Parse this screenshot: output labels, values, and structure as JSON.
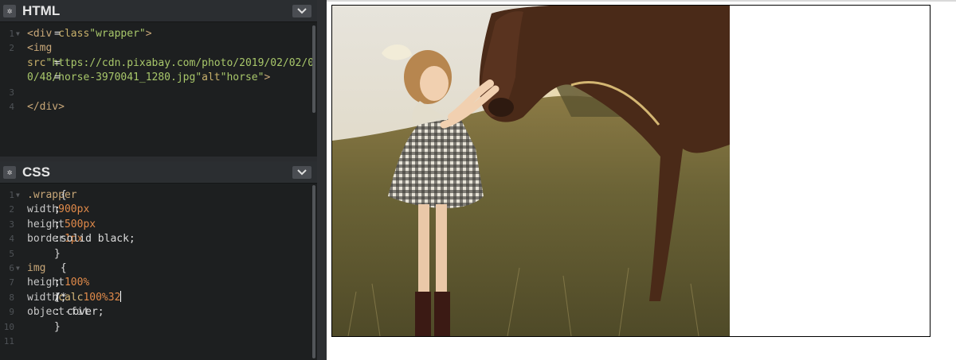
{
  "editor": {
    "html_panel": {
      "title": "HTML",
      "gear_icon": "gear-icon",
      "collapse_icon": "chevron-down-icon",
      "lines": [
        {
          "n": "1",
          "fold": true,
          "parts": [
            [
              "tag",
              "<div "
            ],
            [
              "attr",
              "class"
            ],
            [
              "txt",
              "="
            ],
            [
              "str",
              "\"wrapper\""
            ],
            [
              "tag",
              ">"
            ]
          ]
        },
        {
          "n": "2",
          "fold": false,
          "parts": [
            [
              "txt",
              "  "
            ],
            [
              "tag",
              "<img"
            ]
          ]
        },
        {
          "n": "",
          "fold": false,
          "parts": [
            [
              "attr",
              "src"
            ],
            [
              "txt",
              "="
            ],
            [
              "str",
              "\"https://cdn.pixabay.com/photo/2019/02/02/0"
            ]
          ]
        },
        {
          "n": "",
          "fold": false,
          "parts": [
            [
              "str",
              "0/48/horse-3970041_1280.jpg\""
            ],
            [
              "txt",
              " "
            ],
            [
              "attr",
              "alt"
            ],
            [
              "txt",
              "="
            ],
            [
              "str",
              "\"horse\""
            ],
            [
              "tag",
              ">"
            ]
          ]
        },
        {
          "n": "3",
          "fold": false,
          "parts": []
        },
        {
          "n": "4",
          "fold": false,
          "parts": [
            [
              "tag",
              "</div>"
            ]
          ]
        }
      ]
    },
    "css_panel": {
      "title": "CSS",
      "gear_icon": "gear-icon",
      "collapse_icon": "chevron-down-icon",
      "lines": [
        {
          "n": "1",
          "fold": true,
          "parts": [
            [
              "sel",
              ".wrapper"
            ],
            [
              "txt",
              " {"
            ]
          ]
        },
        {
          "n": "2",
          "fold": false,
          "parts": [
            [
              "txt",
              "  "
            ],
            [
              "prop",
              "width"
            ],
            [
              "txt",
              ": "
            ],
            [
              "num",
              "900px"
            ],
            [
              "txt",
              ";"
            ]
          ]
        },
        {
          "n": "3",
          "fold": false,
          "parts": [
            [
              "txt",
              "  "
            ],
            [
              "prop",
              "height"
            ],
            [
              "txt",
              ": "
            ],
            [
              "num",
              "500px"
            ],
            [
              "txt",
              ";"
            ]
          ]
        },
        {
          "n": "4",
          "fold": false,
          "parts": [
            [
              "txt",
              "  "
            ],
            [
              "prop",
              "border"
            ],
            [
              "txt",
              ": "
            ],
            [
              "num",
              "1px"
            ],
            [
              "txt",
              " solid black;"
            ]
          ]
        },
        {
          "n": "5",
          "fold": false,
          "parts": [
            [
              "txt",
              "}"
            ]
          ]
        },
        {
          "n": "6",
          "fold": true,
          "parts": [
            [
              "sel",
              "img"
            ],
            [
              "txt",
              " {"
            ]
          ]
        },
        {
          "n": "7",
          "fold": false,
          "parts": [
            [
              "txt",
              "  "
            ],
            [
              "prop",
              "height"
            ],
            [
              "txt",
              ": "
            ],
            [
              "num",
              "100%"
            ],
            [
              "txt",
              ";"
            ]
          ]
        },
        {
          "n": "8",
          "fold": false,
          "parts": [
            [
              "txt",
              "  "
            ],
            [
              "prop",
              "width"
            ],
            [
              "txt",
              ": "
            ],
            [
              "fn",
              "calc"
            ],
            [
              "txt",
              "("
            ],
            [
              "num",
              "100%"
            ],
            [
              "txt",
              "/"
            ],
            [
              "num",
              "3"
            ],
            [
              "txt",
              " * "
            ],
            [
              "num",
              "2"
            ],
            [
              "cursor",
              ""
            ],
            [
              "txt",
              ");"
            ]
          ]
        },
        {
          "n": "9",
          "fold": false,
          "parts": [
            [
              "txt",
              "  "
            ],
            [
              "prop",
              "object-fit"
            ],
            [
              "txt",
              ": cover;"
            ]
          ]
        },
        {
          "n": "10",
          "fold": false,
          "parts": [
            [
              "txt",
              "}"
            ]
          ]
        },
        {
          "n": "11",
          "fold": false,
          "parts": []
        }
      ]
    }
  },
  "preview": {
    "image_alt": "horse",
    "image_subject": "girl-petting-horse-photo"
  }
}
